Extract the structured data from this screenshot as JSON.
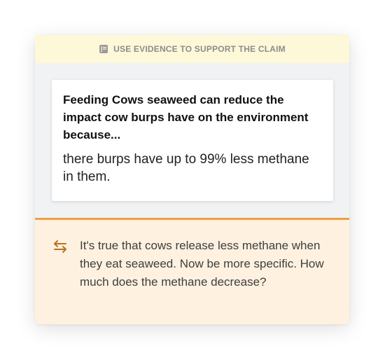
{
  "header": {
    "icon": "book-icon",
    "label": "USE EVIDENCE TO SUPPORT THE CLAIM"
  },
  "response": {
    "prompt": "Feeding Cows seaweed can reduce the impact cow burps have on the environment because...",
    "answer": "there burps have up to 99% less methane in them."
  },
  "feedback": {
    "icon": "revise-arrows-icon",
    "text": "It's true that cows release less methane when they eat seaweed. Now be more specific. How much does the methane decrease?"
  },
  "colors": {
    "header_bg": "#fdf8d8",
    "card_bg": "#f1f2f4",
    "feedback_bg": "#fef1df",
    "feedback_accent": "#f0a040",
    "icon_color": "#b8731e"
  }
}
